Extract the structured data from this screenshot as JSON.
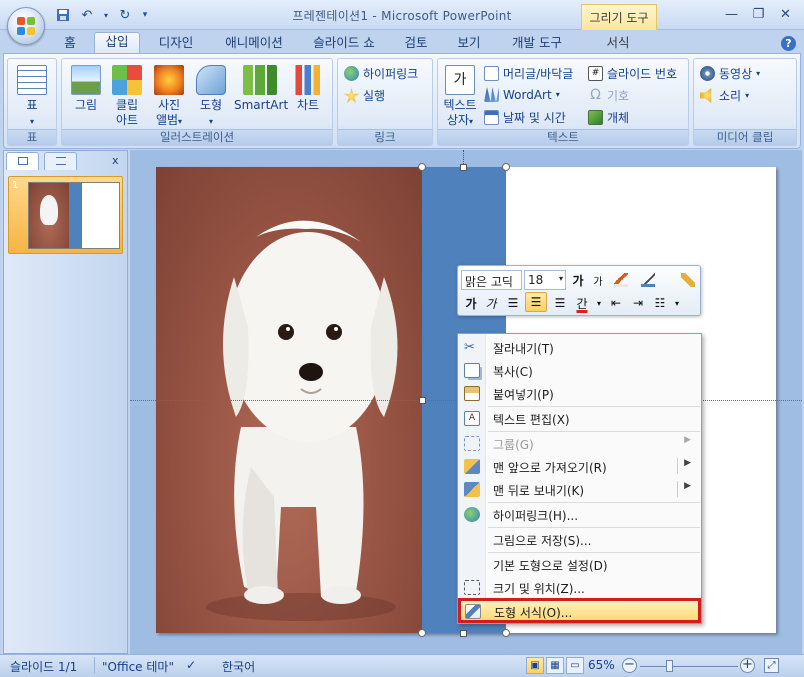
{
  "window": {
    "title": "프레젠테이션1 - Microsoft PowerPoint",
    "context_tab_group": "그리기 도구"
  },
  "quick_access": {
    "save_icon": "save-icon",
    "undo_icon": "undo-icon",
    "redo_icon": "redo-icon"
  },
  "tabs": [
    {
      "label": "홈"
    },
    {
      "label": "삽입"
    },
    {
      "label": "디자인"
    },
    {
      "label": "애니메이션"
    },
    {
      "label": "슬라이드 쇼"
    },
    {
      "label": "검토"
    },
    {
      "label": "보기"
    },
    {
      "label": "개발 도구"
    },
    {
      "label": "서식"
    }
  ],
  "help_glyph": "?",
  "ribbon": {
    "groups": {
      "table": "표",
      "illustrations": "일러스트레이션",
      "links": "링크",
      "text": "텍스트",
      "media": "미디어 클립"
    },
    "buttons": {
      "table": "표",
      "picture": "그림",
      "clipart_1": "클립",
      "clipart_2": "아트",
      "album_1": "사진",
      "album_2": "앨범",
      "shapes": "도형",
      "smartart": "SmartArt",
      "chart": "차트",
      "hyperlink": "하이퍼링크",
      "action": "실행",
      "textbox_1": "텍스트",
      "textbox_2": "상자",
      "header_footer": "머리글/바닥글",
      "wordart": "WordArt",
      "datetime": "날짜 및 시간",
      "slide_number": "슬라이드 번호",
      "symbol": "기호",
      "object": "개체",
      "movie": "동영상",
      "sound": "소리"
    }
  },
  "left_pane": {
    "close": "x",
    "slide_number": "1"
  },
  "mini_toolbar": {
    "font_name": "맑은 고딕",
    "font_size": "18",
    "grow_font": "가",
    "shrink_font": "가",
    "bold": "가",
    "italic": "가",
    "font_color": "간"
  },
  "context_menu": {
    "items": [
      {
        "label": "잘라내기(T)"
      },
      {
        "label": "복사(C)"
      },
      {
        "label": "붙여넣기(P)"
      },
      {
        "label": "텍스트 편집(X)"
      },
      {
        "label": "그룹(G)"
      },
      {
        "label": "맨 앞으로 가져오기(R)"
      },
      {
        "label": "맨 뒤로 보내기(K)"
      },
      {
        "label": "하이퍼링크(H)..."
      },
      {
        "label": "그림으로 저장(S)..."
      },
      {
        "label": "기본 도형으로 설정(D)"
      },
      {
        "label": "크기 및 위치(Z)..."
      },
      {
        "label": "도형 서식(O)..."
      }
    ]
  },
  "status_bar": {
    "slide": "슬라이드 1/1",
    "theme": "\"Office 테마\"",
    "language": "한국어",
    "zoom": "65%"
  },
  "colors": {
    "accent_blue": "#4f81bd",
    "highlight": "#fcd874",
    "annotation_red": "#d11d1d"
  }
}
